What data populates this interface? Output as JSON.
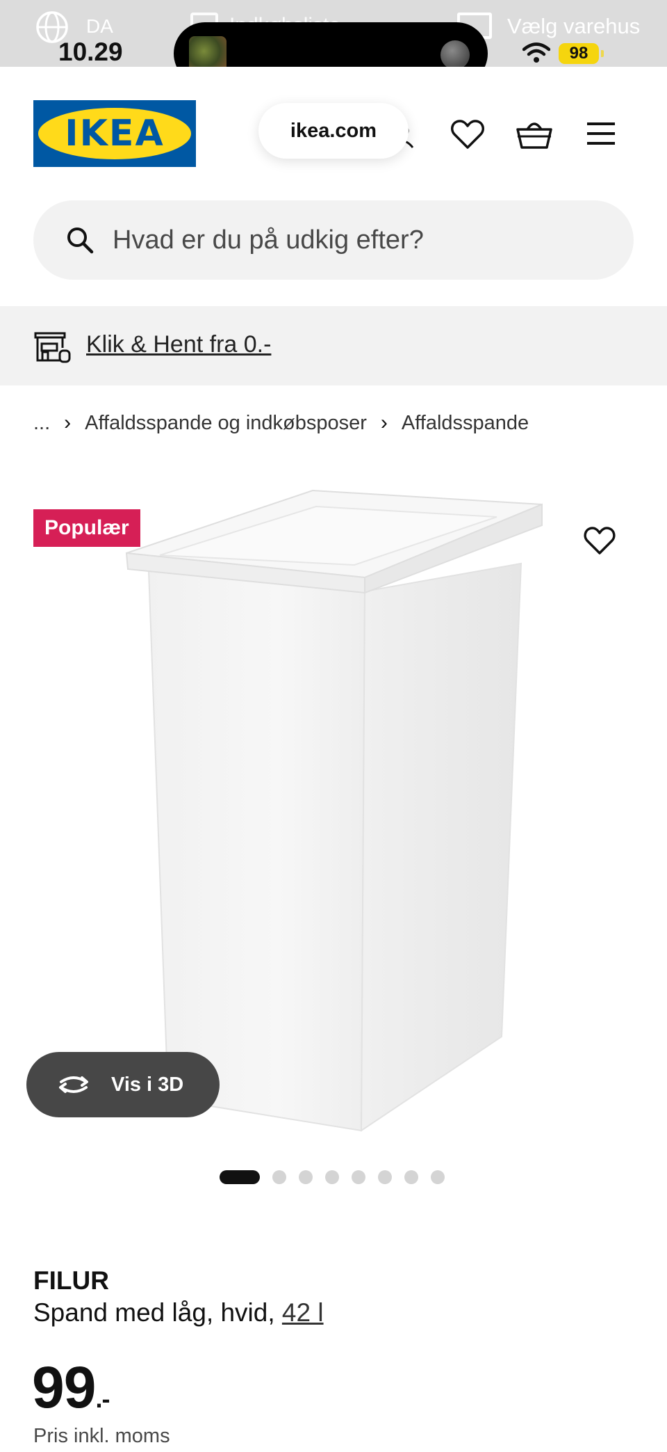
{
  "status_bar": {
    "language": "DA",
    "time": "10.29",
    "faded_label": "Indkøbsliste",
    "store": "Vælg varehus",
    "battery": "98"
  },
  "header": {
    "logo_text": "IKEA",
    "url": "ikea.com"
  },
  "search": {
    "placeholder": "Hvad er du på udkig efter?"
  },
  "pickup": {
    "label": "Klik & Hent fra 0.-"
  },
  "breadcrumb": {
    "ellipsis": "...",
    "items": [
      "Affaldsspande og indkøbsposer",
      "Affaldsspande"
    ]
  },
  "gallery": {
    "badge": "Populær",
    "view_3d": "Vis i 3D",
    "image_count": 8,
    "active_index": 0
  },
  "product": {
    "name": "FILUR",
    "description": "Spand med låg, hvid,",
    "volume": "42 l",
    "price": "99",
    "price_suffix": ".-",
    "price_note": "Pris inkl. moms"
  },
  "colors": {
    "brand_blue": "#0058a3",
    "brand_yellow": "#ffda1a",
    "badge_red": "#d61f56",
    "battery_yellow": "#f5d50e"
  }
}
